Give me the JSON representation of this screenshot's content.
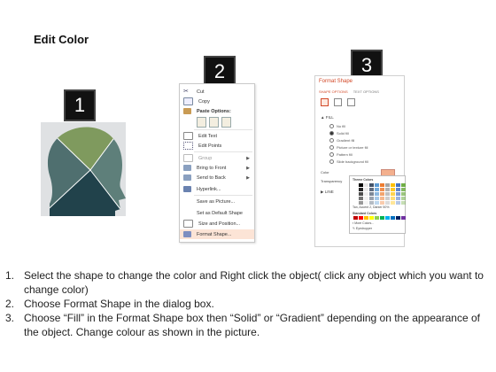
{
  "title": "Edit Color",
  "badges": [
    "1",
    "2",
    "3"
  ],
  "context_menu": {
    "items": [
      {
        "label": "Cut",
        "icon": "scissors-icon",
        "submenu": false
      },
      {
        "label": "Copy",
        "icon": "copy-icon",
        "submenu": false
      },
      {
        "label": "Paste Options:",
        "icon": "clipboard-icon",
        "submenu": false
      },
      {
        "label": "Edit Text",
        "icon": "edit-text-icon",
        "submenu": false
      },
      {
        "label": "Edit Points",
        "icon": "edit-points-icon",
        "submenu": false
      },
      {
        "label": "Group",
        "icon": "group-icon",
        "submenu": true
      },
      {
        "label": "Bring to Front",
        "icon": "bring-front-icon",
        "submenu": true
      },
      {
        "label": "Send to Back",
        "icon": "send-back-icon",
        "submenu": true
      },
      {
        "label": "Hyperlink...",
        "icon": "hyperlink-icon",
        "submenu": false
      },
      {
        "label": "Save as Picture...",
        "icon": "",
        "submenu": false
      },
      {
        "label": "Set as Default Shape",
        "icon": "",
        "submenu": false
      },
      {
        "label": "Size and Position...",
        "icon": "size-icon",
        "submenu": false
      },
      {
        "label": "Format Shape...",
        "icon": "format-shape-icon",
        "submenu": false
      }
    ]
  },
  "format_pane": {
    "title": "Format Shape",
    "tabs": [
      "SHAPE OPTIONS",
      "TEXT OPTIONS"
    ],
    "fill_section": "FILL",
    "fill_options": [
      "No fill",
      "Solid fill",
      "Gradient fill",
      "Picture or texture fill",
      "Pattern fill",
      "Slide background fill"
    ],
    "color_label": "Color",
    "transparency_label": "Transparency",
    "line_section": "LINE",
    "palette": {
      "theme_label": "Theme Colors",
      "tooltip": "Tan, Accent 2, Darker 50%",
      "standard_label": "Standard Colors",
      "more_colors": "More Colors...",
      "eyedropper": "Eyedropper"
    }
  },
  "instructions": [
    {
      "num": "1.",
      "text": "Select the shape to change the color and Right click the object( click any object which you want to change color)"
    },
    {
      "num": "2.",
      "text": "Choose Format Shape in the dialog box."
    },
    {
      "num": "3.",
      "text": "Choose “Fill” in the Format Shape box then “Solid” or “Gradient” depending on the appearance of the object. Change colour as shown in the picture."
    }
  ],
  "colors": {
    "head_top": "#7f9a5e",
    "head_left": "#4f6f6f",
    "head_right": "#5e7f7a",
    "head_bottom": "#21424b",
    "accent": "#d24726"
  }
}
